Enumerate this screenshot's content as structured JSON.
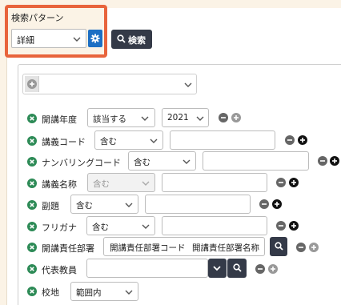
{
  "search_pattern": {
    "label": "検索パターン",
    "selected": "詳細",
    "settings_icon": "gear-icon"
  },
  "search_button": {
    "label": "検索",
    "icon": "search-icon"
  },
  "add_condition": {
    "selected": ""
  },
  "rows": [
    {
      "label": "開講年度",
      "select1": "該当する",
      "select2": "2021"
    },
    {
      "label": "講義コード",
      "select1": "含む",
      "text": ""
    },
    {
      "label": "ナンバリングコード",
      "select1": "含む",
      "text": ""
    },
    {
      "label": "講義名称",
      "select1": "含む",
      "text": ""
    },
    {
      "label": "副題",
      "select1": "含む",
      "text": ""
    },
    {
      "label": "フリガナ",
      "select1": "含む",
      "text": ""
    },
    {
      "label": "開講責任部署",
      "code": "開講責任部署コード",
      "name": "開講責任部署名称"
    },
    {
      "label": "代表教員",
      "text": ""
    },
    {
      "label": "校地",
      "select1": "範囲内"
    }
  ],
  "colors": {
    "highlight": "#e8643c",
    "primary": "#1d6fc4",
    "dark_button": "#343a48",
    "remove_icon": "#2e8b57",
    "background": "#fbf3e6"
  }
}
